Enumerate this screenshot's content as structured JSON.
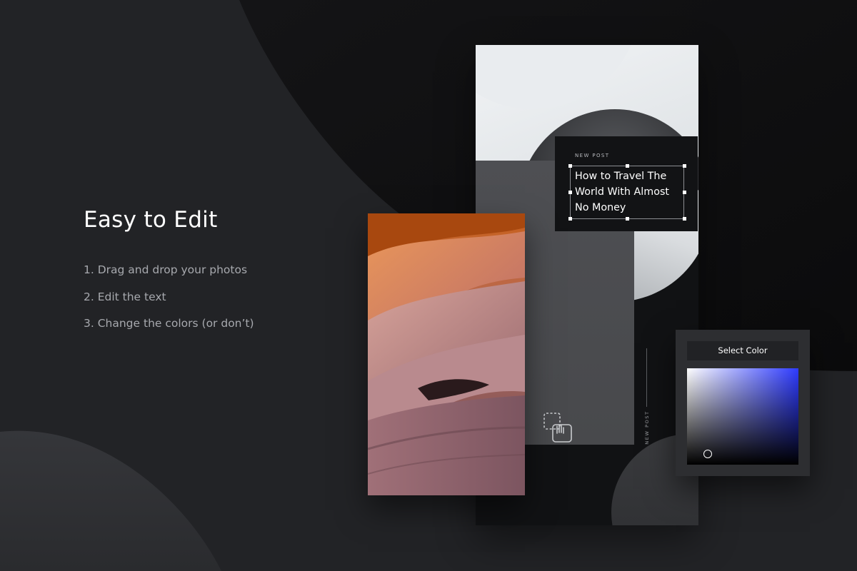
{
  "headline": "Easy to Edit",
  "steps": [
    "1. Drag and drop your photos",
    "2. Edit the text",
    "3. Change the colors (or don’t)"
  ],
  "post": {
    "label": "NEW POST",
    "title": "How to Travel The World With Almost No Money",
    "vertical_label": "NEW POST"
  },
  "color_picker": {
    "title": "Select Color",
    "hue_color": "#2e3bff"
  },
  "icons": {
    "drag": "drag-and-drop-icon"
  },
  "colors": {
    "background": "#222326",
    "panel_dark": "#121315",
    "card_grey": "#4e4f53"
  }
}
